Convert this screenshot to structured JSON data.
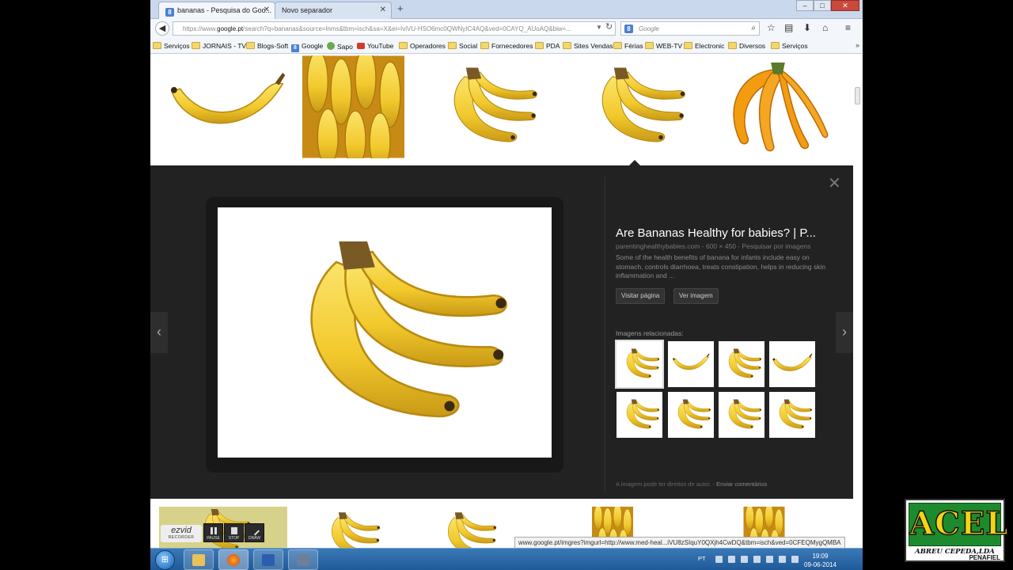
{
  "browser": {
    "tabs": [
      {
        "label": "bananas - Pesquisa do Goo...",
        "favicon": "8",
        "active": true
      },
      {
        "label": "Novo separador",
        "active": false
      }
    ],
    "new_tab": "+",
    "window_buttons": {
      "minimize": "–",
      "maximize": "□",
      "close": "✕"
    },
    "url_prefix": "https://www.",
    "url_domain": "google.pt",
    "url_rest": "/search?q=bananas&source=lnms&tbm=isch&sa=X&ei=IviVU-HSO6mc0QWNyIC4AQ&ved=0CAYQ_AUoAQ&biw=...",
    "search_placeholder": "Google",
    "search_engine_icon": "8"
  },
  "bookmarks": [
    {
      "label": "Serviços",
      "icon": "folder"
    },
    {
      "label": "JORNAIS - TV",
      "icon": "folder"
    },
    {
      "label": "Blogs-Soft",
      "icon": "folder"
    },
    {
      "label": "Google",
      "icon": "google"
    },
    {
      "label": "Sapo",
      "icon": "sapo"
    },
    {
      "label": "YouTube",
      "icon": "youtube"
    },
    {
      "label": "Operadores",
      "icon": "folder"
    },
    {
      "label": "Social",
      "icon": "folder"
    },
    {
      "label": "Fornecedores",
      "icon": "folder"
    },
    {
      "label": "PDA",
      "icon": "folder"
    },
    {
      "label": "Sites Vendas",
      "icon": "folder"
    },
    {
      "label": "Férias",
      "icon": "folder"
    },
    {
      "label": "WEB-TV",
      "icon": "folder"
    },
    {
      "label": "Electronic",
      "icon": "folder"
    },
    {
      "label": "Diversos",
      "icon": "folder"
    },
    {
      "label": "Serviços",
      "icon": "folder"
    }
  ],
  "bookmarks_more": "»",
  "detail": {
    "title": "Are Bananas Healthy for babies? | P...",
    "source": "parentinghealthybabies.com - 600 × 450 - Pesquisar por imagens",
    "description": "Some of the health benefits of banana for infants include easy on stomach, controls diarrhoea, treats constipation, helps in reducing skin inflammation and ...",
    "visit_button": "Visitar página",
    "view_button": "Ver imagem",
    "related_label": "Imagens relacionadas:",
    "footer_text": "A imagem pode ter direitos de autor.",
    "footer_link": "Enviar comentários",
    "prev_arrow": "‹",
    "next_arrow": "›",
    "close": "✕"
  },
  "status_url": "www.google.pt/imgres?imgurl=http://www.med-heal...iVU8zSIquY0QXjh4CwDQ&tbm=isch&ved=0CFEQMygQMBA",
  "ezvid": {
    "logo": "ezvid",
    "logo_sub": "RECORDER",
    "buttons": [
      "PAUSE",
      "STOP",
      "DRAW"
    ]
  },
  "taskbar": {
    "start": "⊞",
    "language": "PT",
    "time": "19:09",
    "date": "09-06-2014"
  },
  "acel": {
    "name": "ACEL",
    "subtitle": "ABREU CEPEDA,LDA",
    "city": "PENAFIEL"
  },
  "colors": {
    "banana_yellow": "#f6d23a",
    "banana_shade": "#d9a91c",
    "detail_bg": "#222222"
  }
}
